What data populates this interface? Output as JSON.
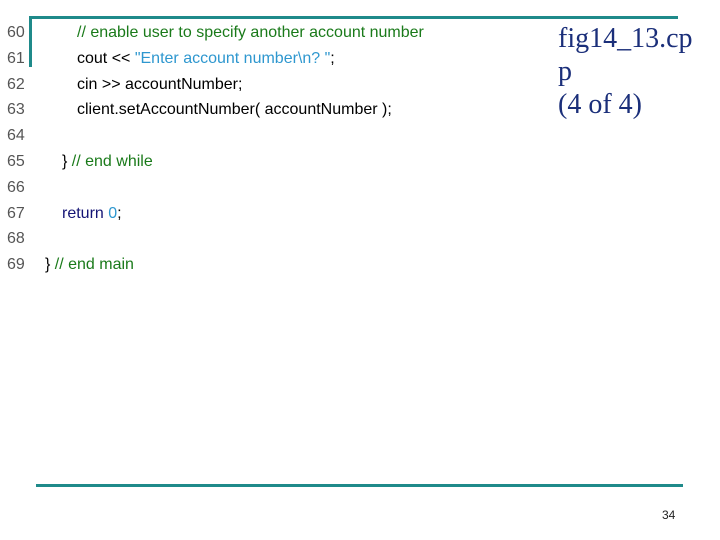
{
  "code": {
    "lines": [
      {
        "number": "60",
        "indent": 2,
        "tokens": [
          {
            "type": "comment",
            "text": "// enable user to specify another account number"
          }
        ]
      },
      {
        "number": "61",
        "indent": 2,
        "tokens": [
          {
            "type": "plain",
            "text": "cout << "
          },
          {
            "type": "string",
            "text": "\"Enter account number\\n? \""
          },
          {
            "type": "plain",
            "text": ";"
          }
        ]
      },
      {
        "number": "62",
        "indent": 2,
        "tokens": [
          {
            "type": "plain",
            "text": "cin >> accountNumber;"
          }
        ]
      },
      {
        "number": "63",
        "indent": 2,
        "tokens": [
          {
            "type": "plain",
            "text": "client.setAccountNumber( accountNumber );"
          }
        ]
      },
      {
        "number": "64",
        "indent": 2,
        "tokens": []
      },
      {
        "number": "65",
        "indent": 1,
        "tokens": [
          {
            "type": "plain",
            "text": "} "
          },
          {
            "type": "comment",
            "text": "// end while"
          }
        ]
      },
      {
        "number": "66",
        "indent": 1,
        "tokens": []
      },
      {
        "number": "67",
        "indent": 1,
        "tokens": [
          {
            "type": "keyword",
            "text": "return "
          },
          {
            "type": "number",
            "text": "0"
          },
          {
            "type": "plain",
            "text": ";"
          }
        ]
      },
      {
        "number": "68",
        "indent": 1,
        "tokens": []
      },
      {
        "number": "69",
        "indent": 0,
        "tokens": [
          {
            "type": "plain",
            "text": "} "
          },
          {
            "type": "comment",
            "text": "// end main"
          }
        ]
      }
    ]
  },
  "figure": {
    "title_line1": "fig14_13.cp",
    "title_line2": "p",
    "title_line3": "(4 of 4)"
  },
  "slide": {
    "page_number": "34"
  },
  "colors": {
    "accent_rule": "#1f8a8a",
    "comment": "#1a7a1a",
    "string": "#2e97cf",
    "keyword": "#141475",
    "number": "#2e97cf",
    "line_number": "#555555",
    "title": "#1b2f7a"
  }
}
